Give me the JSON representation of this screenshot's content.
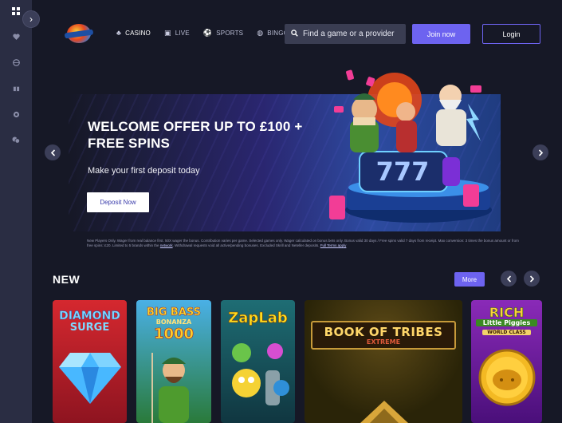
{
  "sidebar": {
    "icons": [
      "grid-icon",
      "heart-icon",
      "globe-icon",
      "gift-icon",
      "settings-icon",
      "chat-icon"
    ],
    "toggle_glyph": "›"
  },
  "header": {
    "nav": [
      {
        "label": "CASINO",
        "icon": "♣",
        "active": true
      },
      {
        "label": "LIVE",
        "icon": "▣",
        "active": false
      },
      {
        "label": "SPORTS",
        "icon": "⚽",
        "active": false
      },
      {
        "label": "BINGO",
        "icon": "◍",
        "active": false
      }
    ],
    "search_placeholder": "Find a game or a provider",
    "join_label": "Join now",
    "login_label": "Login"
  },
  "hero": {
    "title": "WELCOME OFFER UP TO £100 + FREE SPINS",
    "subtitle": "Make your first deposit today",
    "cta": "Deposit Now",
    "reel": "777",
    "terms": "New Players Only. Wager from real balance first. 50X wager the bonus. Contribution varies per game. Selected games only. Wager calculated on bonus bets only. Bonus valid 30 days / Free spins valid 7 days from receipt. Max conversion: 3 times the bonus amount or from free spins: £20. Limited to 5 brands within the",
    "terms_link1": "network",
    "terms_mid": ". Withdrawal requests void all active/pending bonuses. Excluded Skrill and Neteller deposits.",
    "terms_link2": "Full Terms apply"
  },
  "new_section": {
    "title": "NEW",
    "more_label": "More",
    "games": [
      {
        "line1": "DIAMOND",
        "line2": "SURGE",
        "line3": ""
      },
      {
        "line1": "BIG BASS",
        "line2": "BONANZA",
        "line3": "1000"
      },
      {
        "line1": "ZapLab",
        "line2": "",
        "line3": ""
      },
      {
        "line1": "BOOK OF TRIBES",
        "line2": "EXTREME",
        "line3": ""
      },
      {
        "line1": "RICH",
        "line2": "Little Piggies",
        "line3": "WORLD CLASS"
      }
    ]
  },
  "colors": {
    "background": "#161826",
    "rail": "#2a2d43",
    "accent": "#6d63f0"
  }
}
